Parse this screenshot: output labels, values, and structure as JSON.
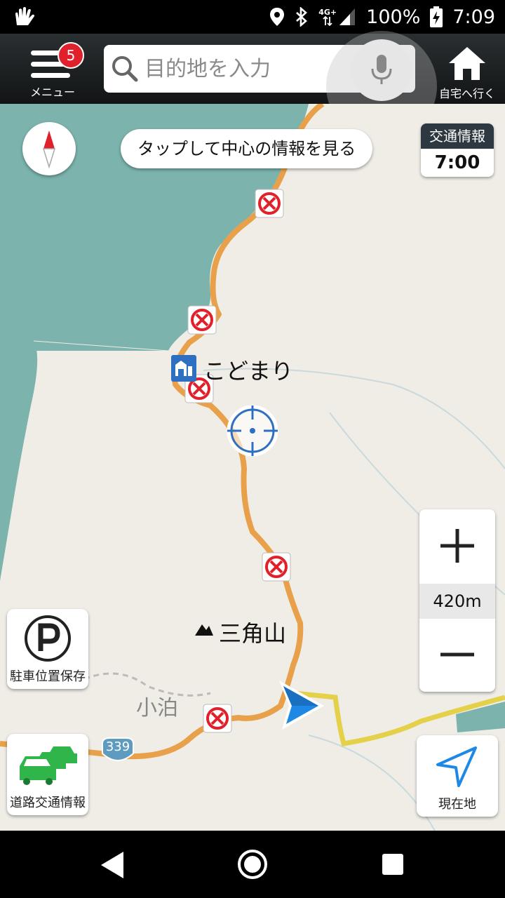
{
  "status_bar": {
    "battery_percent": "100%",
    "time": "7:09",
    "network": "4G+"
  },
  "top_bar": {
    "menu_label": "メニュー",
    "menu_badge": "5",
    "search_placeholder": "目的地を入力",
    "home_label": "自宅へ行く"
  },
  "map": {
    "tap_hint": "タップして中心の情報を見る",
    "traffic_info_title": "交通情報",
    "traffic_info_time": "7:00",
    "place_kodomari": "こどまり",
    "place_sankakuyama": "三角山",
    "place_kodomari_kanji": "小泊",
    "route_number": "339",
    "zoom_scale": "420m"
  },
  "buttons": {
    "parking_save": "駐車位置保存",
    "road_traffic": "道路交通情報",
    "current_location": "現在地"
  },
  "colors": {
    "sea": "#7cb3ad",
    "land": "#efede6",
    "route": "#e8a14a",
    "route_alt": "#e5d04a",
    "topbar": "#1b1f21",
    "accent_blue": "#1e88e5",
    "badge_red": "#e0202a"
  }
}
